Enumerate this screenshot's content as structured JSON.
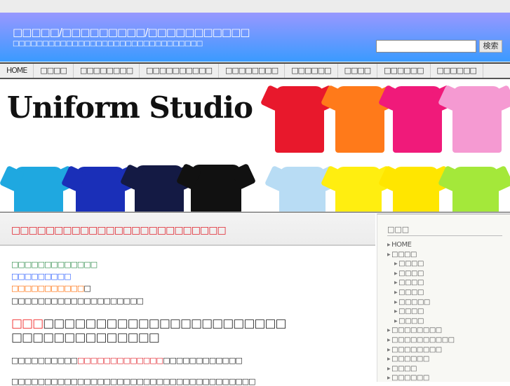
{
  "header": {
    "title": "□□□□□/□□□□□□□□□/□□□□□□□□□□□",
    "description": "□□□□□□□□□□□□□□□□□□□□□□□□□□□□□□□□",
    "search_placeholder": "",
    "search_button": "検索"
  },
  "nav": {
    "items": [
      "HOME",
      "□□□□",
      "□□□□□□□□",
      "□□□□□□□□□□",
      "□□□□□□□□",
      "□□□□□□",
      "□□□□",
      "□□□□□□",
      "□□□□□□"
    ]
  },
  "banner": {
    "logo": "Uniform Studio"
  },
  "main": {
    "title": "□□□□□□□□□□□□□□□□□□□□□□□□□",
    "lines": [
      {
        "text": "□□□□□□□□□□□□□",
        "color": "#2e8b4a"
      },
      {
        "text": "□□□□□□□□□",
        "color": "#2a5cff"
      },
      {
        "text": "□□□□□□□□□□□",
        "color": "#ff6a00",
        "suffix": "□"
      },
      {
        "text": "□□□□□□□□□□□□□□□□□□□□",
        "color": "#222"
      }
    ],
    "heading_red": "□□□",
    "heading_rest": "□□□□□□□□□□□□□□□□□□□□□□□",
    "heading_line2": "□□□□□□□□□□□□□□",
    "para1_a": "□□□□□□□□□□",
    "para1_red": "□□□□□□□□□□□□□",
    "para1_b": "□□□□□□□□□□□□",
    "para2": "□□□□□□□□□□□□□□□□□□□□□□□□□□□□□□□□□□□□□"
  },
  "sidebar": {
    "heading": "□□□",
    "items": [
      {
        "label": "HOME",
        "sub": false
      },
      {
        "label": "□□□□",
        "sub": false
      },
      {
        "label": "□□□□",
        "sub": true
      },
      {
        "label": "□□□□",
        "sub": true
      },
      {
        "label": "□□□□",
        "sub": true
      },
      {
        "label": "□□□□",
        "sub": true
      },
      {
        "label": "□□□□□",
        "sub": true
      },
      {
        "label": "□□□□",
        "sub": true
      },
      {
        "label": "□□□□",
        "sub": true
      },
      {
        "label": "□□□□□□□□",
        "sub": false
      },
      {
        "label": "□□□□□□□□□□",
        "sub": false
      },
      {
        "label": "□□□□□□□□",
        "sub": false
      },
      {
        "label": "□□□□□□",
        "sub": false
      },
      {
        "label": "□□□□",
        "sub": false
      },
      {
        "label": "□□□□□□",
        "sub": false
      }
    ]
  },
  "colors": {
    "header_top": "#9898ff",
    "header_bottom": "#3a9aff",
    "title_red": "#e0202a"
  }
}
